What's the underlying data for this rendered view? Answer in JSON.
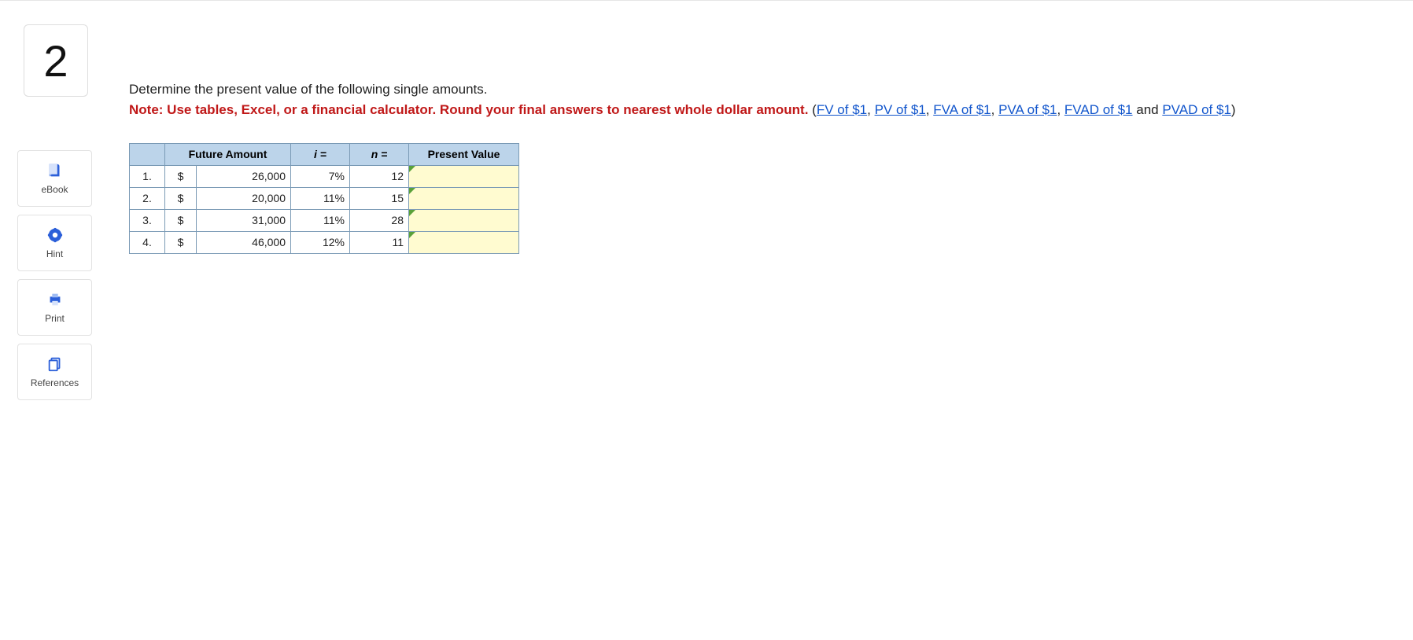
{
  "question_number": "2",
  "sidebar": {
    "ebook": "eBook",
    "hint": "Hint",
    "print": "Print",
    "references": "References"
  },
  "prompt": {
    "line1": "Determine the present value of the following single amounts.",
    "note_prefix": "Note: Use tables, Excel, or a financial calculator. Round your final answers to nearest whole dollar amount.",
    "paren_open": " (",
    "link_fv": "FV of $1",
    "link_pv": "PV of $1",
    "link_fva": "FVA of $1",
    "link_pva": "PVA of $1",
    "link_fvad": "FVAD of $1",
    "link_pvad": "PVAD of $1",
    "and": " and ",
    "sep": ", ",
    "paren_close": ")"
  },
  "table": {
    "headers": {
      "future_amount": "Future Amount",
      "i": "i =",
      "n": "n =",
      "pv": "Present Value"
    },
    "rows": [
      {
        "num": "1.",
        "cur": "$",
        "amount": "26,000",
        "i": "7%",
        "n": "12",
        "pv": ""
      },
      {
        "num": "2.",
        "cur": "$",
        "amount": "20,000",
        "i": "11%",
        "n": "15",
        "pv": ""
      },
      {
        "num": "3.",
        "cur": "$",
        "amount": "31,000",
        "i": "11%",
        "n": "28",
        "pv": ""
      },
      {
        "num": "4.",
        "cur": "$",
        "amount": "46,000",
        "i": "12%",
        "n": "11",
        "pv": ""
      }
    ]
  }
}
